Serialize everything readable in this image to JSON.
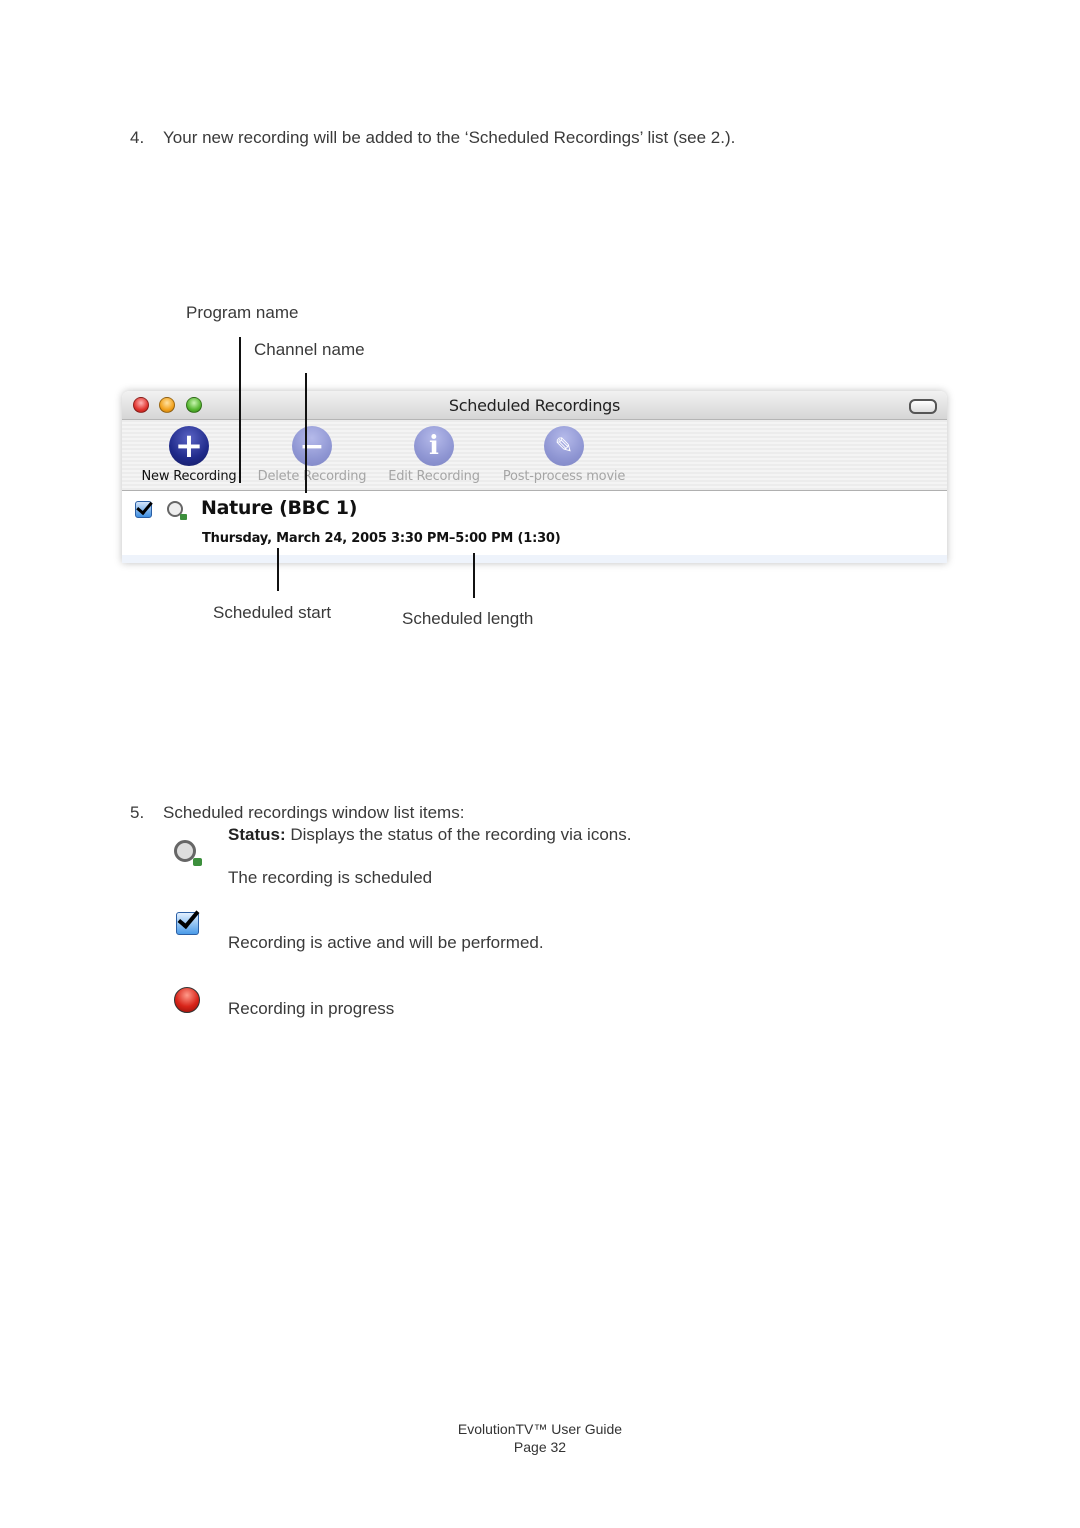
{
  "step4": {
    "number": "4.",
    "text": "Your new recording will be added to the ‘Scheduled Recordings’ list (see 2.)."
  },
  "callouts": {
    "program_name": "Program name",
    "channel_name": "Channel name",
    "scheduled_start": "Scheduled start",
    "scheduled_length": "Scheduled length"
  },
  "window": {
    "title": "Scheduled Recordings",
    "toolbar": [
      {
        "label": "New Recording",
        "icon": "plus-icon",
        "glyph": "+",
        "enabled": true
      },
      {
        "label": "Delete Recording",
        "icon": "minus-icon",
        "glyph": "−",
        "enabled": false
      },
      {
        "label": "Edit Recording",
        "icon": "info-icon",
        "glyph": "i",
        "enabled": false
      },
      {
        "label": "Post-process movie",
        "icon": "wand-icon",
        "glyph": "✎",
        "enabled": false
      }
    ],
    "recording": {
      "active": true,
      "status": "scheduled",
      "title": "Nature (BBC 1)",
      "schedule": "Thursday, March 24, 2005  3:30 PM–5:00 PM (1:30)"
    }
  },
  "step5": {
    "number": "5.",
    "text": "Scheduled recordings window list items:",
    "status_label": "Status:",
    "status_text": " Displays the status of the recording via icons.",
    "items": [
      {
        "icon": "scheduled-clock-icon",
        "text": "The recording is scheduled"
      },
      {
        "icon": "active-checkbox-icon",
        "text": "Recording is active and will be performed."
      },
      {
        "icon": "recording-in-progress-icon",
        "text": "Recording in progress"
      }
    ]
  },
  "footer": {
    "title": "EvolutionTV™ User Guide",
    "page": "Page 32"
  }
}
